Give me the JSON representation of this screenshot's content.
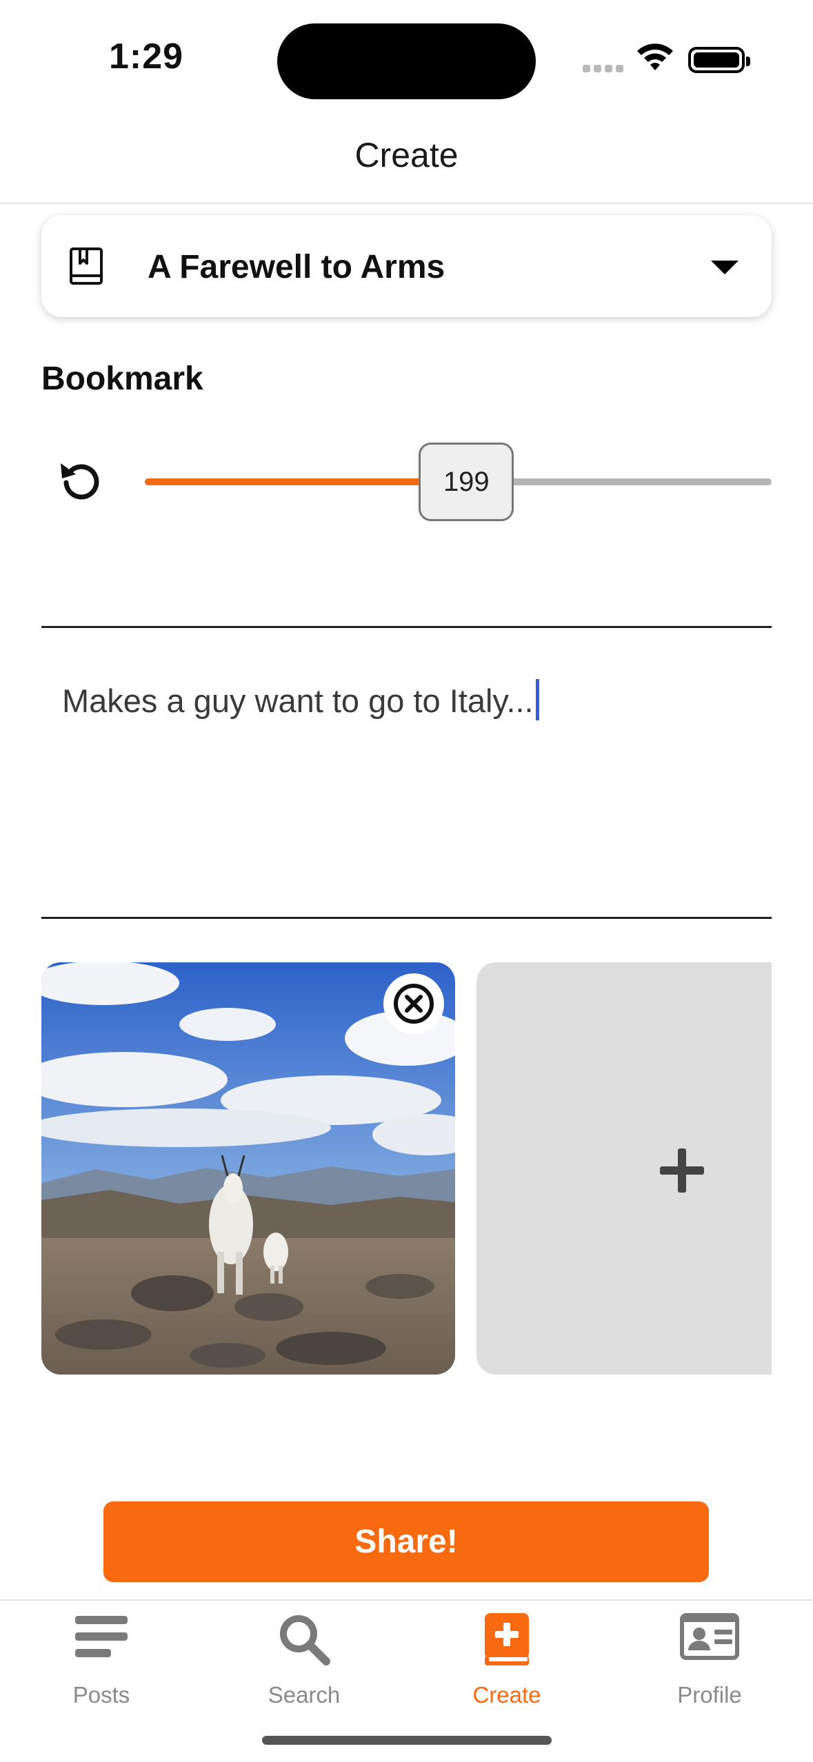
{
  "status_bar": {
    "time": "1:29"
  },
  "nav": {
    "title": "Create"
  },
  "book_picker": {
    "selected_book": "A Farewell to Arms",
    "icon": "book-icon"
  },
  "bookmark": {
    "label": "Bookmark",
    "page_value": "199",
    "slider_fraction": 0.513
  },
  "post_text": {
    "value": "Makes a guy want to go to Italy..."
  },
  "photos": {
    "attached": [
      {
        "description_icon": "photo-thumbnail",
        "remove_icon": "close-circle-icon"
      }
    ],
    "add_icon": "plus-icon"
  },
  "share_button": {
    "label": "Share!"
  },
  "tab_bar": {
    "items": [
      {
        "label": "Posts",
        "icon": "list-icon",
        "active": false
      },
      {
        "label": "Search",
        "icon": "search-icon",
        "active": false
      },
      {
        "label": "Create",
        "icon": "create-book-icon",
        "active": true
      },
      {
        "label": "Profile",
        "icon": "id-card-icon",
        "active": false
      }
    ]
  },
  "colors": {
    "accent": "#f76a0f",
    "slider_fill": "#f26c13",
    "inactive_tab": "#8a8a8a",
    "add_tile_bg": "#dedede"
  }
}
